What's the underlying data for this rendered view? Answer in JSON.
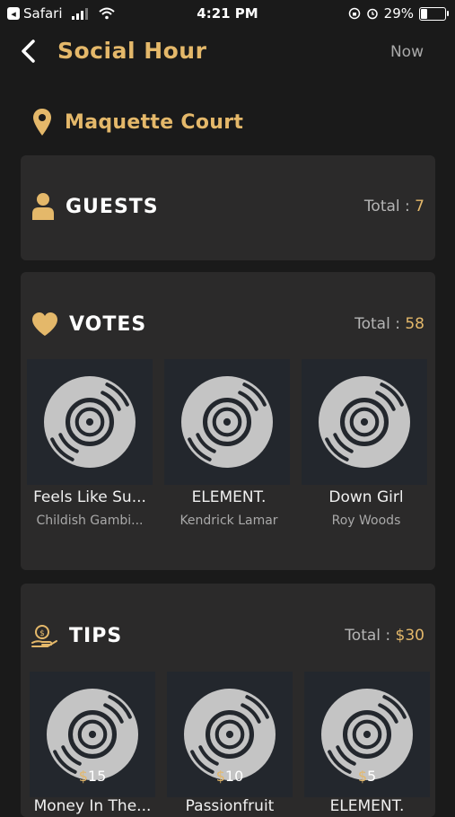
{
  "status_bar": {
    "carrier": "Safari",
    "time": "4:21 PM",
    "battery": "29%",
    "battery_level": 0.29
  },
  "nav": {
    "title": "Social Hour",
    "right_label": "Now"
  },
  "location": {
    "name": "Maquette Court"
  },
  "guests": {
    "title": "GUESTS",
    "total_label": "Total : ",
    "total_value": "7"
  },
  "votes": {
    "title": "VOTES",
    "total_label": "Total : ",
    "total_value": "58",
    "items": [
      {
        "title": "Feels Like Su...",
        "artist": "Childish Gambi..."
      },
      {
        "title": "ELEMENT.",
        "artist": "Kendrick Lamar"
      },
      {
        "title": "Down Girl",
        "artist": "Roy Woods"
      }
    ]
  },
  "tips": {
    "title": "TIPS",
    "total_label": "Total : ",
    "total_value": "$30",
    "items": [
      {
        "currency": "$",
        "amount": "15",
        "title": "Money In The..."
      },
      {
        "currency": "$",
        "amount": "10",
        "title": "Passionfruit"
      },
      {
        "currency": "$",
        "amount": "5",
        "title": "ELEMENT."
      }
    ]
  },
  "colors": {
    "accent": "#e4b86a",
    "background": "#1a1a1a",
    "card": "#2b2a2a",
    "tile": "#23272d"
  }
}
